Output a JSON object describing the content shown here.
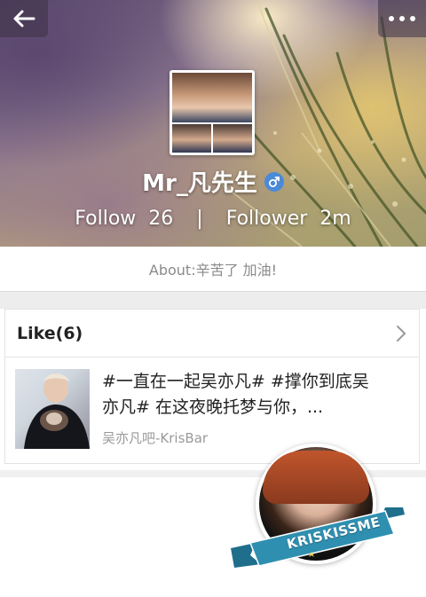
{
  "header": {
    "back_icon": "back-arrow-icon",
    "more_icon": "more-dots-icon"
  },
  "profile": {
    "name": "Mr_凡先生",
    "gender_icon": "male-gender-icon",
    "follow_label": "Follow",
    "follow_count": "26",
    "separator": "|",
    "follower_label": "Follower",
    "follower_count": "2m",
    "about": "About:辛苦了 加油!"
  },
  "likes": {
    "title": "Like(6)",
    "chevron_icon": "chevron-right-icon",
    "item": {
      "text": "#一直在一起吴亦凡# #撑你到底吴亦凡# 在这夜晚托梦与你，...",
      "source": "吴亦凡吧-KrisBar"
    }
  },
  "badge": {
    "ribbon_text": "KRISKISSME"
  },
  "colors": {
    "accent_blue": "#4a8ad8",
    "ribbon_blue": "#2f8fb0",
    "text_primary": "#222222",
    "text_secondary": "#9a9a9a"
  }
}
